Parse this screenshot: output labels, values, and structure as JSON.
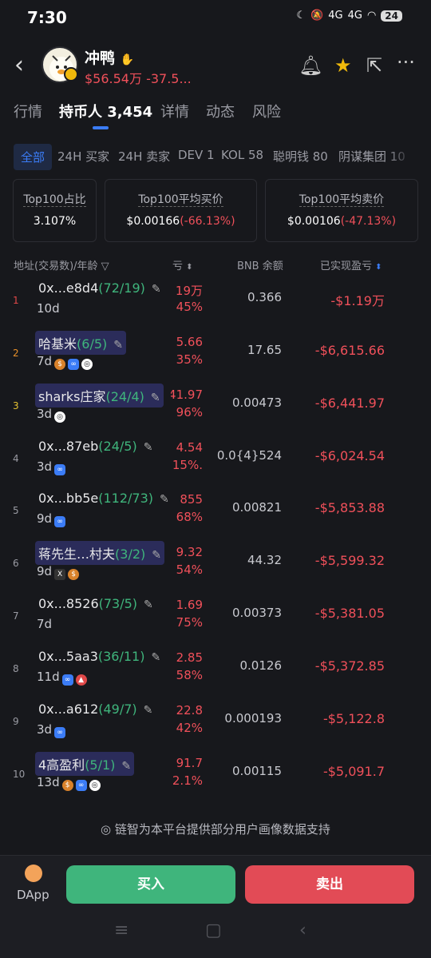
{
  "status_bar": {
    "time": "7:30",
    "battery": "24",
    "signal1": "4G",
    "signal2": "4G"
  },
  "token": {
    "name": "冲鸭",
    "price_line": "$56.54万 -37.5..."
  },
  "tabs": [
    "行情",
    "持币人 3,454",
    "详情",
    "动态",
    "风险"
  ],
  "filters": [
    "全部",
    "24H 买家",
    "24H 卖家",
    "DEV 1",
    "KOL 58",
    "聪明钱 80",
    "阴谋集团 10"
  ],
  "stats": [
    {
      "label": "Top100占比",
      "value": "3.107%",
      "change": ""
    },
    {
      "label": "Top100平均买价",
      "value": "$0.00166",
      "change": "(-66.13%)"
    },
    {
      "label": "Top100平均卖价",
      "value": "$0.00106",
      "change": "(-47.13%)"
    }
  ],
  "columns": {
    "address": "地址(交易数)/年龄",
    "pnl": "亏",
    "bnb": "BNB 余额",
    "realized": "已实现盈亏"
  },
  "holders": [
    {
      "rank": "1",
      "address": "0x...e8d4",
      "trades": "(72/19)",
      "age": "10d",
      "pnl_value": "19万",
      "pnl_percent": "45%",
      "bnb": "0.366",
      "realized": "-$1.19万",
      "tagged": false,
      "badges": []
    },
    {
      "rank": "2",
      "address": "哈基米",
      "trades": "(6/5)",
      "age": "7d",
      "pnl_value": "5.66",
      "pnl_percent": "35%",
      "bnb": "17.65",
      "realized": "-$6,615.66",
      "tagged": true,
      "badges": [
        "bag",
        "link",
        "circle"
      ]
    },
    {
      "rank": "3",
      "address": "sharks庄家",
      "trades": "(24/4)",
      "age": "3d",
      "pnl_value": "41.97",
      "pnl_percent": "96%",
      "bnb": "0.00473",
      "realized": "-$6,441.97",
      "tagged": true,
      "badges": [
        "circle"
      ]
    },
    {
      "rank": "4",
      "address": "0x...87eb",
      "trades": "(24/5)",
      "age": "3d",
      "pnl_value": "4.54",
      "pnl_percent": ".15%",
      "bnb": "0.0{4}524",
      "realized": "-$6,024.54",
      "tagged": false,
      "badges": [
        "link"
      ]
    },
    {
      "rank": "5",
      "address": "0x...bb5e",
      "trades": "(112/73)",
      "age": "9d",
      "pnl_value": "855",
      "pnl_percent": "68%",
      "bnb": "0.00821",
      "realized": "-$5,853.88",
      "tagged": false,
      "badges": [
        "link"
      ]
    },
    {
      "rank": "6",
      "address": "蒋先生…村夫",
      "trades": "(3/2)",
      "age": "9d",
      "pnl_value": "9.32",
      "pnl_percent": "54%",
      "bnb": "44.32",
      "realized": "-$5,599.32",
      "tagged": true,
      "badges": [
        "x",
        "bag"
      ]
    },
    {
      "rank": "7",
      "address": "0x...8526",
      "trades": "(73/5)",
      "age": "7d",
      "pnl_value": "1.69",
      "pnl_percent": "75%",
      "bnb": "0.00373",
      "realized": "-$5,381.05",
      "tagged": false,
      "badges": []
    },
    {
      "rank": "8",
      "address": "0x...5aa3",
      "trades": "(36/11)",
      "age": "11d",
      "pnl_value": "2.85",
      "pnl_percent": "58%",
      "bnb": "0.0126",
      "realized": "-$5,372.85",
      "tagged": false,
      "badges": [
        "link",
        "rocket"
      ]
    },
    {
      "rank": "9",
      "address": "0x...a612",
      "trades": "(49/7)",
      "age": "3d",
      "pnl_value": "22.8",
      "pnl_percent": "42%",
      "bnb": "0.000193",
      "realized": "-$5,122.8",
      "tagged": false,
      "badges": [
        "link"
      ]
    },
    {
      "rank": "10",
      "address": "4高盈利",
      "trades": "(5/1)",
      "age": "13d",
      "pnl_value": "91.7",
      "pnl_percent": "2.1%",
      "bnb": "0.00115",
      "realized": "-$5,091.7",
      "tagged": true,
      "badges": [
        "bag",
        "link",
        "circle"
      ]
    }
  ],
  "footnote": "链智为本平台提供部分用户画像数据支持",
  "bottom": {
    "dapp": "DApp",
    "buy": "买入",
    "sell": "卖出"
  },
  "colors": {
    "up": "#3fb57c",
    "down": "#f0505a",
    "accent": "#3b7cf6",
    "background": "#17181c"
  }
}
